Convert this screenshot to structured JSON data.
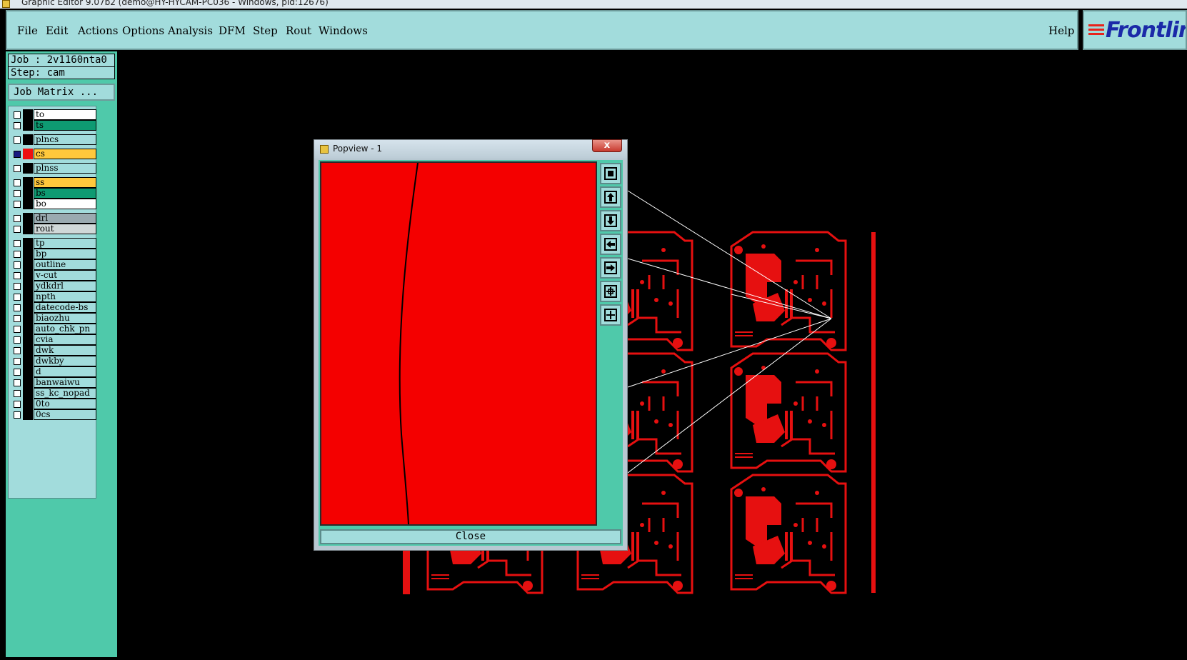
{
  "window": {
    "title": "Graphic Editor 9.07b2 (demo@HY-HYCAM-PC036 - Windows, pid:12676)"
  },
  "menu": {
    "items": [
      "File",
      "Edit",
      "Actions",
      "Options",
      "Analysis",
      "DFM",
      "Step",
      "Rout",
      "Windows"
    ],
    "help": "Help"
  },
  "logo": {
    "text": "Frontlin"
  },
  "job": {
    "job_line": "Job : 2v1160nta0",
    "step_line": "Step: cam",
    "matrix_button": "Job Matrix ..."
  },
  "layers": [
    {
      "name": "to",
      "color": "#ffffff",
      "swatch": "#000000",
      "active": false
    },
    {
      "name": "ts",
      "color": "#0e9a72",
      "swatch": "#000000",
      "active": false
    },
    {
      "name": "plncs",
      "color": "#a2dcdc",
      "swatch": "#000000",
      "active": false
    },
    {
      "name": "cs",
      "color": "#ffc83c",
      "swatch": "#ee1111",
      "active": true
    },
    {
      "name": "plnss",
      "color": "#a2dcdc",
      "swatch": "#000000",
      "active": false
    },
    {
      "name": "ss",
      "color": "#ffc83c",
      "swatch": "#000000",
      "active": false
    },
    {
      "name": "bs",
      "color": "#0e9a72",
      "swatch": "#000000",
      "active": false
    },
    {
      "name": "bo",
      "color": "#ffffff",
      "swatch": "#000000",
      "active": false
    },
    {
      "name": "drl",
      "color": "#9aaab0",
      "swatch": "#000000",
      "active": false
    },
    {
      "name": "rout",
      "color": "#d0d8d8",
      "swatch": "#000000",
      "active": false
    },
    {
      "name": "tp",
      "color": "#a2dcdc",
      "swatch": "#000000",
      "active": false
    },
    {
      "name": "bp",
      "color": "#a2dcdc",
      "swatch": "#000000",
      "active": false
    },
    {
      "name": "outline",
      "color": "#a2dcdc",
      "swatch": "#000000",
      "active": false
    },
    {
      "name": "v-cut",
      "color": "#a2dcdc",
      "swatch": "#000000",
      "active": false
    },
    {
      "name": "ydkdrl",
      "color": "#a2dcdc",
      "swatch": "#000000",
      "active": false
    },
    {
      "name": "npth",
      "color": "#a2dcdc",
      "swatch": "#000000",
      "active": false
    },
    {
      "name": "datecode-bs",
      "color": "#a2dcdc",
      "swatch": "#000000",
      "active": false
    },
    {
      "name": "biaozhu",
      "color": "#a2dcdc",
      "swatch": "#000000",
      "active": false
    },
    {
      "name": "auto_chk_pn",
      "color": "#a2dcdc",
      "swatch": "#000000",
      "active": false
    },
    {
      "name": "cvia",
      "color": "#a2dcdc",
      "swatch": "#000000",
      "active": false
    },
    {
      "name": "dwk",
      "color": "#a2dcdc",
      "swatch": "#000000",
      "active": false
    },
    {
      "name": "dwkby",
      "color": "#a2dcdc",
      "swatch": "#000000",
      "active": false
    },
    {
      "name": "d",
      "color": "#a2dcdc",
      "swatch": "#000000",
      "active": false
    },
    {
      "name": "banwaiwu",
      "color": "#a2dcdc",
      "swatch": "#000000",
      "active": false
    },
    {
      "name": "ss_kc_nopad",
      "color": "#a2dcdc",
      "swatch": "#000000",
      "active": false
    },
    {
      "name": "0to",
      "color": "#a2dcdc",
      "swatch": "#000000",
      "active": false
    },
    {
      "name": "0cs",
      "color": "#a2dcdc",
      "swatch": "#000000",
      "active": false
    }
  ],
  "popview": {
    "title": "Popview - 1",
    "close_x": "x",
    "close_button": "Close",
    "tools": [
      "zoom-home-icon",
      "pan-up-icon",
      "pan-down-icon",
      "pan-left-icon",
      "pan-right-icon",
      "zoom-out-icon",
      "zoom-in-icon"
    ]
  },
  "colors": {
    "accent": "#a2dcdc",
    "panel": "#4fc9aa",
    "copper": "#f40000"
  }
}
